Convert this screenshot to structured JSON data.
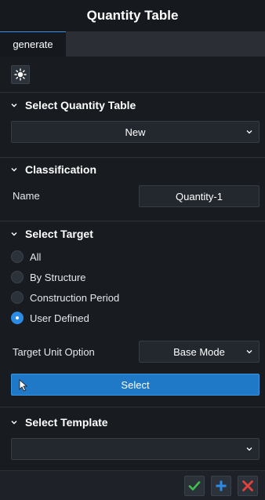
{
  "window": {
    "title": "Quantity Table"
  },
  "tabs": [
    {
      "label": "generate"
    }
  ],
  "toolbar": {
    "icon": "sun-icon"
  },
  "select_quantity_table": {
    "header": "Select Quantity Table",
    "dropdown_value": "New"
  },
  "classification": {
    "header": "Classification",
    "name_label": "Name",
    "name_value": "Quantity-1"
  },
  "select_target": {
    "header": "Select Target",
    "options": [
      {
        "label": "All",
        "checked": false
      },
      {
        "label": "By Structure",
        "checked": false
      },
      {
        "label": "Construction Period",
        "checked": false
      },
      {
        "label": "User Defined",
        "checked": true
      }
    ],
    "target_unit_label": "Target Unit Option",
    "target_unit_value": "Base Mode",
    "select_button_label": "Select"
  },
  "select_template": {
    "header": "Select Template",
    "dropdown_value": ""
  },
  "footer": {
    "buttons": [
      "check-icon",
      "plus-icon",
      "close-icon"
    ]
  },
  "colors": {
    "accent": "#2b8be6",
    "select_button": "#1f79c7",
    "ok": "#3fbf4f",
    "add": "#2b8be6",
    "cancel": "#e0433b"
  }
}
